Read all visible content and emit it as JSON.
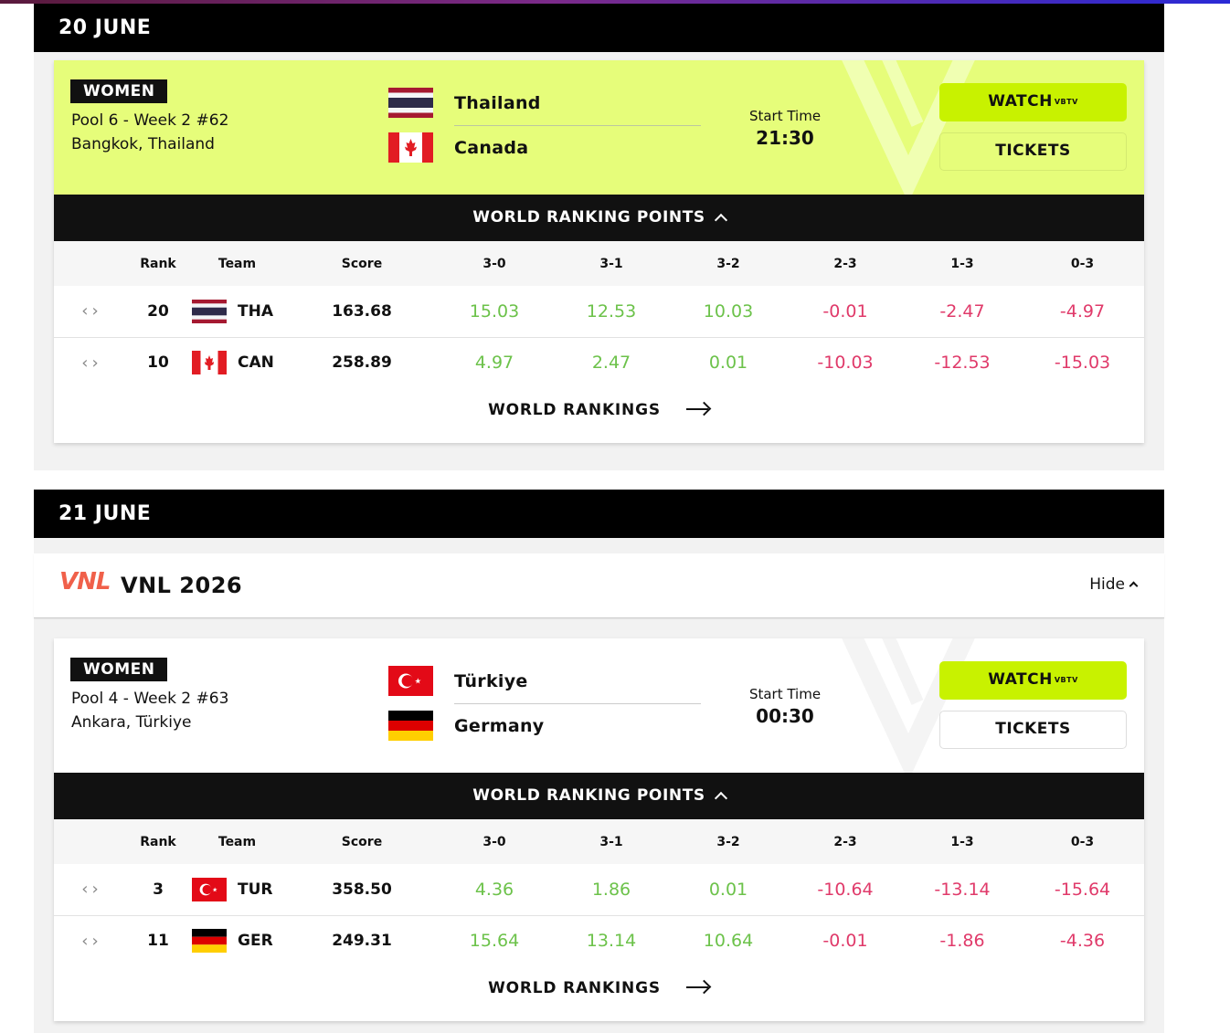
{
  "days": [
    {
      "date": "20 JUNE",
      "match": {
        "gender": "WOMEN",
        "pool": "Pool 6 - Week 2 #62",
        "location": "Bangkok, Thailand",
        "home": "Thailand",
        "away": "Canada",
        "start_label": "Start Time",
        "start_time": "21:30",
        "watch": "WATCH",
        "watch_brand": "VBTV",
        "tickets": "TICKETS",
        "ranking_title": "WORLD RANKING POINTS",
        "headers": [
          "Rank",
          "Team",
          "Score",
          "3-0",
          "3-1",
          "3-2",
          "2-3",
          "1-3",
          "0-3"
        ],
        "rows": [
          {
            "rank": "20",
            "code": "THA",
            "score": "163.68",
            "p30": "15.03",
            "p31": "12.53",
            "p32": "10.03",
            "p23": "-0.01",
            "p13": "-2.47",
            "p03": "-4.97"
          },
          {
            "rank": "10",
            "code": "CAN",
            "score": "258.89",
            "p30": "4.97",
            "p31": "2.47",
            "p32": "0.01",
            "p23": "-10.03",
            "p13": "-12.53",
            "p03": "-15.03"
          }
        ],
        "world_rankings": "WORLD RANKINGS"
      }
    },
    {
      "date": "21 JUNE",
      "competition": {
        "logo": "VNL",
        "title": "VNL 2026",
        "toggle": "Hide"
      },
      "match": {
        "gender": "WOMEN",
        "pool": "Pool 4 - Week 2 #63",
        "location": "Ankara, Türkiye",
        "home": "Türkiye",
        "away": "Germany",
        "start_label": "Start Time",
        "start_time": "00:30",
        "watch": "WATCH",
        "watch_brand": "VBTV",
        "tickets": "TICKETS",
        "ranking_title": "WORLD RANKING POINTS",
        "headers": [
          "Rank",
          "Team",
          "Score",
          "3-0",
          "3-1",
          "3-2",
          "2-3",
          "1-3",
          "0-3"
        ],
        "rows": [
          {
            "rank": "3",
            "code": "TUR",
            "score": "358.50",
            "p30": "4.36",
            "p31": "1.86",
            "p32": "0.01",
            "p23": "-10.64",
            "p13": "-13.14",
            "p03": "-15.64"
          },
          {
            "rank": "11",
            "code": "GER",
            "score": "249.31",
            "p30": "15.64",
            "p31": "13.14",
            "p32": "10.64",
            "p23": "-0.01",
            "p13": "-1.86",
            "p03": "-4.36"
          }
        ],
        "world_rankings": "WORLD RANKINGS"
      }
    }
  ],
  "colors": {
    "lime_card": "#e6fd7a",
    "watch_button": "#c8f200",
    "positive": "#6cc24a",
    "negative": "#e03a6a"
  },
  "icons": {
    "nav": "chevron-left-right-icon",
    "arrow": "arrow-right-icon",
    "expand": "chevron-up-icon"
  }
}
